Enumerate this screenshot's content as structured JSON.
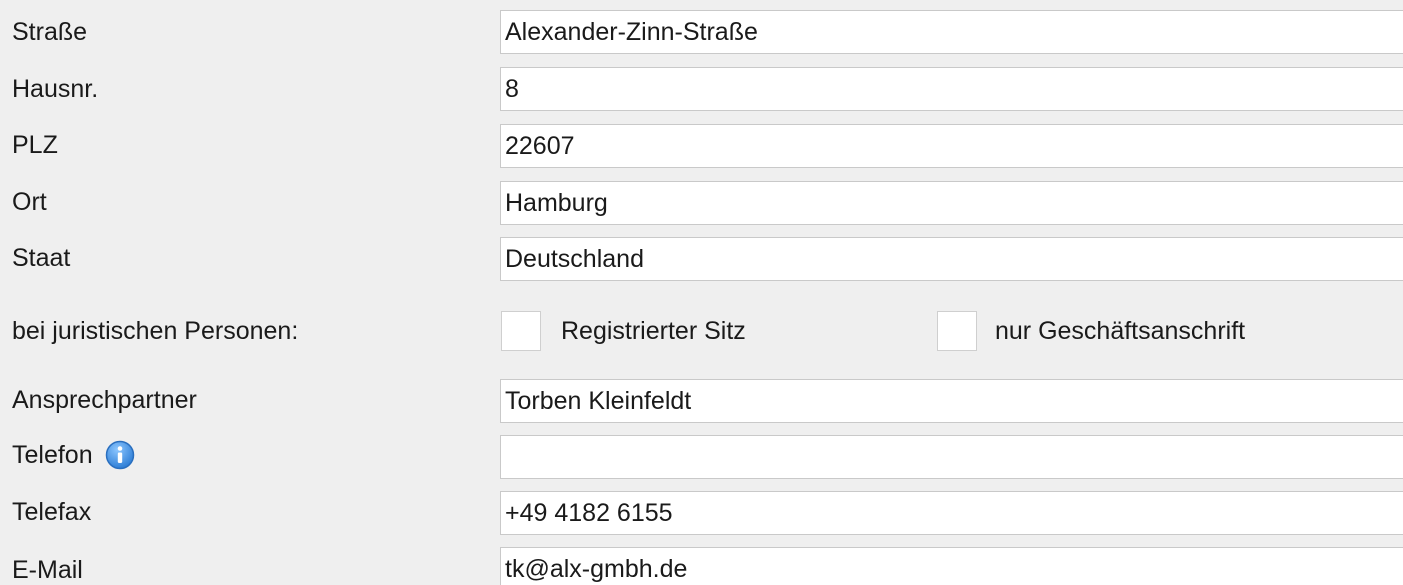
{
  "fields": {
    "strasse": {
      "label": "Straße",
      "value": "Alexander-Zinn-Straße"
    },
    "hausnr": {
      "label": "Hausnr.",
      "value": "8"
    },
    "plz": {
      "label": "PLZ",
      "value": "22607"
    },
    "ort": {
      "label": "Ort",
      "value": "Hamburg"
    },
    "staat": {
      "label": "Staat",
      "value": "Deutschland"
    },
    "ansprechpartner": {
      "label": "Ansprechpartner",
      "value": "Torben Kleinfeldt"
    },
    "telefon": {
      "label": "Telefon",
      "value": ""
    },
    "telefax": {
      "label": "Telefax",
      "value": "+49 4182 6155"
    },
    "email": {
      "label": "E-Mail",
      "value": "tk@alx-gmbh.de"
    }
  },
  "juristische": {
    "label": "bei juristischen Personen:",
    "registrierter_sitz": {
      "label": "Registrierter Sitz",
      "checked": false
    },
    "nur_geschaeftsanschrift": {
      "label": "nur Geschäftsanschrift",
      "checked": false
    }
  },
  "icons": {
    "telefon_info": "info-icon"
  },
  "colors": {
    "background": "#efefef",
    "field_background": "#ffffff",
    "field_border": "#c9c9c9",
    "info_icon": "#3d8fe0"
  }
}
